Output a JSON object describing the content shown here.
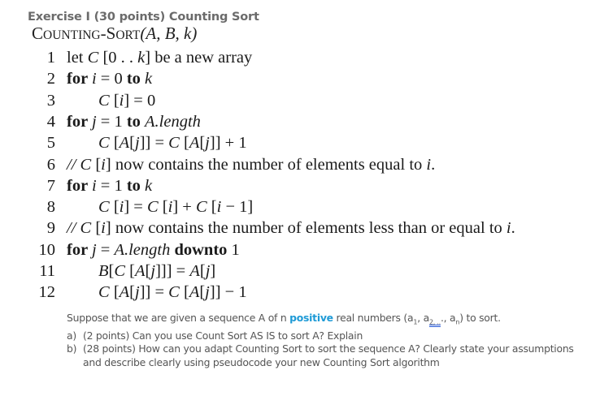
{
  "exercise": {
    "title": "Exercise I (30 points) Counting Sort"
  },
  "algorithm": {
    "name_first": "C",
    "name_rest1": "OUNTING",
    "name_dash": "-",
    "name_s": "S",
    "name_rest2": "ORT",
    "args": "(A, B, k)",
    "lines": [
      {
        "num": "1",
        "parts": [
          {
            "t": "let ",
            "s": "rm"
          },
          {
            "t": "C",
            "s": "it"
          },
          {
            "t": " [0 . . ",
            "s": "rm"
          },
          {
            "t": "k",
            "s": "it"
          },
          {
            "t": "] be a new array",
            "s": "rm"
          }
        ],
        "indent": false
      },
      {
        "num": "2",
        "parts": [
          {
            "t": "for ",
            "s": "kw"
          },
          {
            "t": "i",
            "s": "it"
          },
          {
            "t": " = 0 ",
            "s": "rm"
          },
          {
            "t": "to ",
            "s": "kw"
          },
          {
            "t": "k",
            "s": "it"
          }
        ],
        "indent": false
      },
      {
        "num": "3",
        "parts": [
          {
            "t": "C",
            "s": "it"
          },
          {
            "t": " [",
            "s": "rm"
          },
          {
            "t": "i",
            "s": "it"
          },
          {
            "t": "] = 0",
            "s": "rm"
          }
        ],
        "indent": true
      },
      {
        "num": "4",
        "parts": [
          {
            "t": "for ",
            "s": "kw"
          },
          {
            "t": "j",
            "s": "it"
          },
          {
            "t": " = 1 ",
            "s": "rm"
          },
          {
            "t": "to ",
            "s": "kw"
          },
          {
            "t": "A.length",
            "s": "it"
          }
        ],
        "indent": false
      },
      {
        "num": "5",
        "parts": [
          {
            "t": "C",
            "s": "it"
          },
          {
            "t": " [",
            "s": "rm"
          },
          {
            "t": "A",
            "s": "it"
          },
          {
            "t": "[",
            "s": "rm"
          },
          {
            "t": "j",
            "s": "it"
          },
          {
            "t": "]] = ",
            "s": "rm"
          },
          {
            "t": "C",
            "s": "it"
          },
          {
            "t": " [",
            "s": "rm"
          },
          {
            "t": "A",
            "s": "it"
          },
          {
            "t": "[",
            "s": "rm"
          },
          {
            "t": "j",
            "s": "it"
          },
          {
            "t": "]] + 1",
            "s": "rm"
          }
        ],
        "indent": true
      },
      {
        "num": "6",
        "parts": [
          {
            "t": "// ",
            "s": "it"
          },
          {
            "t": "C",
            "s": "it"
          },
          {
            "t": " [",
            "s": "rm"
          },
          {
            "t": "i",
            "s": "it"
          },
          {
            "t": "] now contains the number of elements equal to ",
            "s": "rm"
          },
          {
            "t": "i",
            "s": "it"
          },
          {
            "t": ".",
            "s": "rm"
          }
        ],
        "indent": false
      },
      {
        "num": "7",
        "parts": [
          {
            "t": "for ",
            "s": "kw"
          },
          {
            "t": "i",
            "s": "it"
          },
          {
            "t": " = 1 ",
            "s": "rm"
          },
          {
            "t": "to ",
            "s": "kw"
          },
          {
            "t": "k",
            "s": "it"
          }
        ],
        "indent": false
      },
      {
        "num": "8",
        "parts": [
          {
            "t": "C",
            "s": "it"
          },
          {
            "t": " [",
            "s": "rm"
          },
          {
            "t": "i",
            "s": "it"
          },
          {
            "t": "] = ",
            "s": "rm"
          },
          {
            "t": "C",
            "s": "it"
          },
          {
            "t": " [",
            "s": "rm"
          },
          {
            "t": "i",
            "s": "it"
          },
          {
            "t": "] + ",
            "s": "rm"
          },
          {
            "t": "C",
            "s": "it"
          },
          {
            "t": " [",
            "s": "rm"
          },
          {
            "t": "i",
            "s": "it"
          },
          {
            "t": " − 1]",
            "s": "rm"
          }
        ],
        "indent": true
      },
      {
        "num": "9",
        "parts": [
          {
            "t": "// ",
            "s": "it"
          },
          {
            "t": "C",
            "s": "it"
          },
          {
            "t": " [",
            "s": "rm"
          },
          {
            "t": "i",
            "s": "it"
          },
          {
            "t": "] now contains the number of elements less than or equal to ",
            "s": "rm"
          },
          {
            "t": "i",
            "s": "it"
          },
          {
            "t": ".",
            "s": "rm"
          }
        ],
        "indent": false
      },
      {
        "num": "10",
        "parts": [
          {
            "t": "for ",
            "s": "kw"
          },
          {
            "t": "j",
            "s": "it"
          },
          {
            "t": " = ",
            "s": "rm"
          },
          {
            "t": "A.length",
            "s": "it"
          },
          {
            "t": " downto ",
            "s": "kw"
          },
          {
            "t": "1",
            "s": "rm"
          }
        ],
        "indent": false
      },
      {
        "num": "11",
        "parts": [
          {
            "t": "B",
            "s": "it"
          },
          {
            "t": "[",
            "s": "rm"
          },
          {
            "t": "C",
            "s": "it"
          },
          {
            "t": " [",
            "s": "rm"
          },
          {
            "t": "A",
            "s": "it"
          },
          {
            "t": "[",
            "s": "rm"
          },
          {
            "t": "j",
            "s": "it"
          },
          {
            "t": "]]] = ",
            "s": "rm"
          },
          {
            "t": "A",
            "s": "it"
          },
          {
            "t": "[",
            "s": "rm"
          },
          {
            "t": "j",
            "s": "it"
          },
          {
            "t": "]",
            "s": "rm"
          }
        ],
        "indent": true
      },
      {
        "num": "12",
        "parts": [
          {
            "t": "C",
            "s": "it"
          },
          {
            "t": " [",
            "s": "rm"
          },
          {
            "t": "A",
            "s": "it"
          },
          {
            "t": "[",
            "s": "rm"
          },
          {
            "t": "j",
            "s": "it"
          },
          {
            "t": "]] = ",
            "s": "rm"
          },
          {
            "t": "C",
            "s": "it"
          },
          {
            "t": " [",
            "s": "rm"
          },
          {
            "t": "A",
            "s": "it"
          },
          {
            "t": "[",
            "s": "rm"
          },
          {
            "t": "j",
            "s": "it"
          },
          {
            "t": "]] − 1",
            "s": "rm"
          }
        ],
        "indent": true
      }
    ]
  },
  "question": {
    "intro_before": "Suppose that we are given a sequence A of n ",
    "intro_highlight": "positive",
    "intro_after": " real numbers (a",
    "sub1": "1",
    "sep1": ", a",
    "sub2": "2, ..",
    "sep2": "., a",
    "subn": "n",
    "intro_end": ") to sort.",
    "highlight_color": "#1e9ad6",
    "items": [
      {
        "label": "a)",
        "text": "(2 points) Can you use Count Sort AS IS to sort A? Explain"
      },
      {
        "label": "b)",
        "text": "(28 points) How can you adapt Counting Sort to sort the sequence A? Clearly state your assumptions and describe clearly using pseudocode your new Counting Sort algorithm"
      }
    ]
  }
}
